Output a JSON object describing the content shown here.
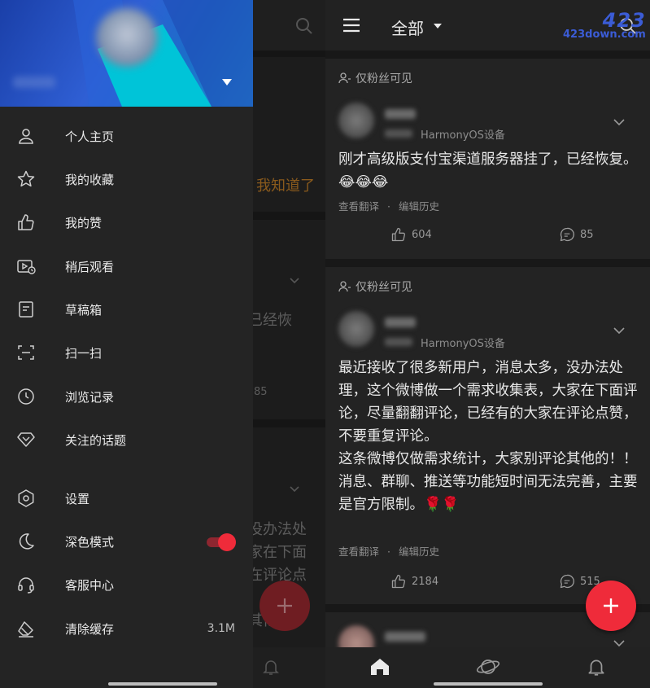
{
  "drawer": {
    "menu": [
      {
        "label": "个人主页",
        "icon": "person-icon"
      },
      {
        "label": "我的收藏",
        "icon": "star-icon"
      },
      {
        "label": "我的赞",
        "icon": "thumb-up-icon"
      },
      {
        "label": "稍后观看",
        "icon": "watch-later-icon"
      },
      {
        "label": "草稿箱",
        "icon": "draft-icon"
      },
      {
        "label": "扫一扫",
        "icon": "scan-icon"
      },
      {
        "label": "浏览记录",
        "icon": "clock-icon"
      },
      {
        "label": "关注的话题",
        "icon": "diamond-icon"
      },
      {
        "label": "设置",
        "icon": "settings-icon"
      },
      {
        "label": "深色模式",
        "icon": "moon-icon"
      },
      {
        "label": "客服中心",
        "icon": "headset-icon"
      },
      {
        "label": "清除缓存",
        "icon": "eraser-icon",
        "value": "3.1M"
      }
    ],
    "dark_mode_on": true
  },
  "left_bg": {
    "got_it": "我知道了",
    "frag1": "已经恢",
    "frag2": "85",
    "frag3": "没办法处",
    "frag4": "家在下面",
    "frag5": "在评论点",
    "frag6": "其他"
  },
  "feed": {
    "title": "全部",
    "watermark": {
      "top": "423",
      "bottom": "423down.com"
    },
    "posts": [
      {
        "visibility": "仅粉丝可见",
        "device": "HarmonyOS设备",
        "text": "刚才高级版支付宝渠道服务器挂了，已经恢复。😂😂😂",
        "translate": "查看翻译",
        "sep": "·",
        "history": "编辑历史",
        "likes": "604",
        "comments": "85"
      },
      {
        "visibility": "仅粉丝可见",
        "device": "HarmonyOS设备",
        "text": "最近接收了很多新用户，消息太多，没办法处理，这个微博做一个需求收集表，大家在下面评论，尽量翻翻评论，已经有的大家在评论点赞，不要重复评论。\n这条微博仅做需求统计，大家别评论其他的！！\n消息、群聊、推送等功能短时间无法完善，主要是官方限制。🌹🌹",
        "translate": "查看翻译",
        "sep": "·",
        "history": "编辑历史",
        "likes": "2184",
        "comments": "515"
      }
    ]
  },
  "colors": {
    "accent": "#ef2b3a",
    "background": "#181818",
    "card": "#232323"
  }
}
